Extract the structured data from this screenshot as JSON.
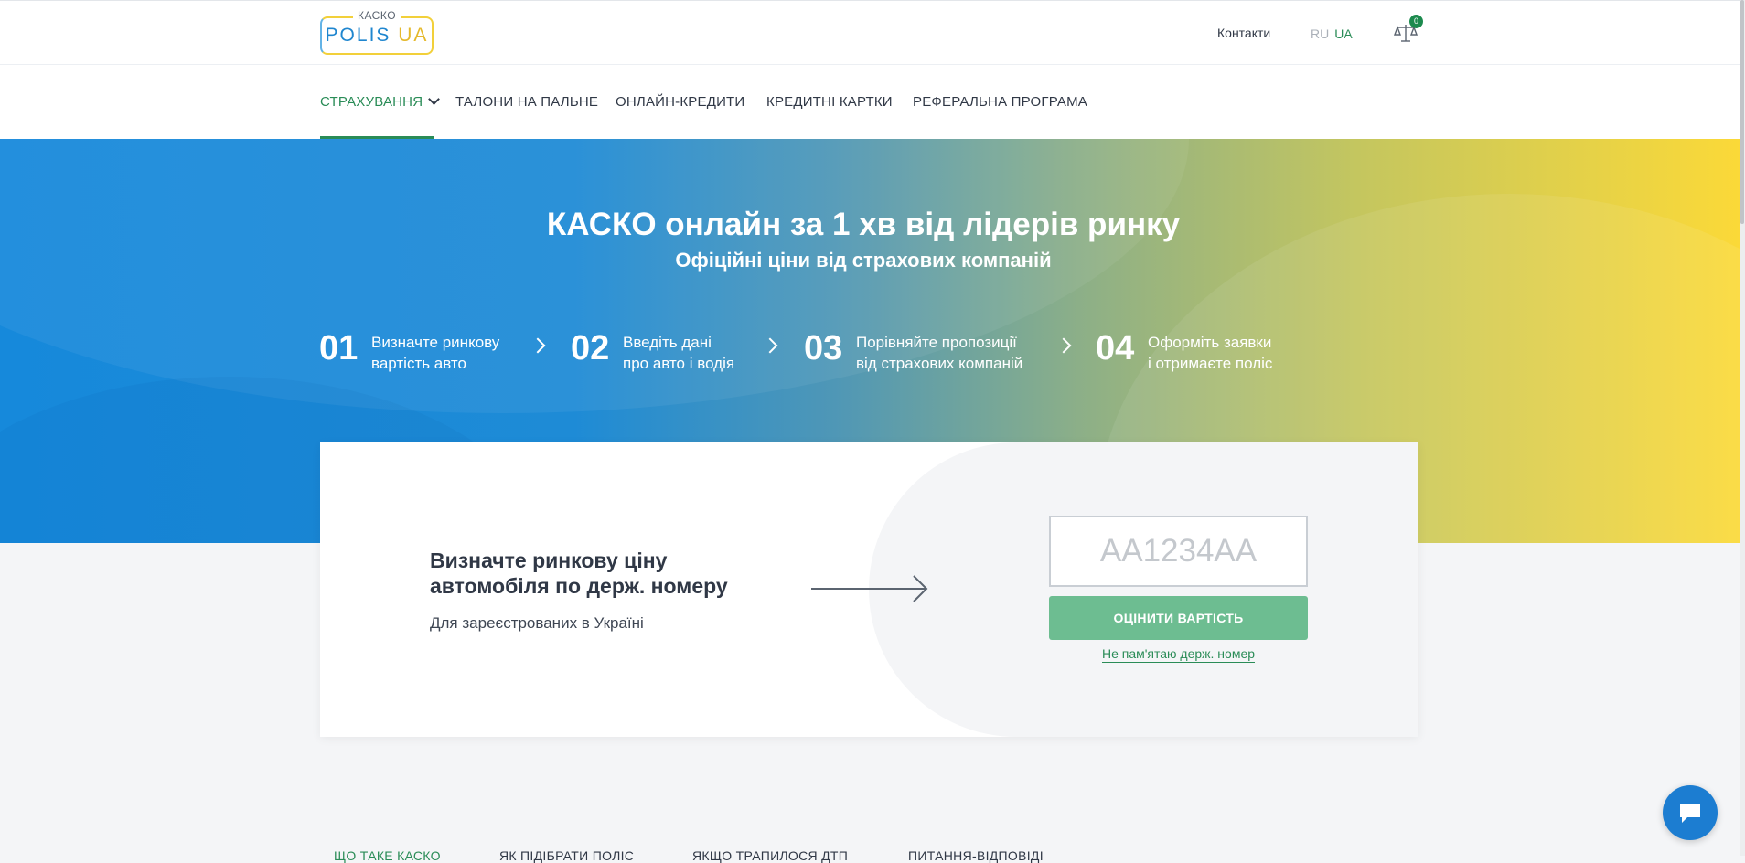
{
  "header": {
    "logo_top": "КАСКО",
    "logo_main": "POLIS",
    "logo_ua": "UA",
    "contacts": "Контакти",
    "lang_ru": "RU",
    "lang_ua": "UA",
    "compare_count": "0",
    "compare_icon": "scales-icon"
  },
  "nav": {
    "items": [
      {
        "label": "СТРАХУВАННЯ"
      },
      {
        "label": "ТАЛОНИ НА ПАЛЬНЕ"
      },
      {
        "label": "ОНЛАЙН-КРЕДИТИ"
      },
      {
        "label": "КРЕДИТНІ КАРТКИ"
      },
      {
        "label": "РЕФЕРАЛЬНА ПРОГРАМА"
      }
    ]
  },
  "hero": {
    "title": "КАСКО онлайн за 1 хв від лідерів ринку",
    "subtitle": "Офіційні ціни від страхових компаній",
    "steps": [
      {
        "num": "01",
        "line1": "Визначте ринкову",
        "line2": "вартість авто"
      },
      {
        "num": "02",
        "line1": "Введіть дані",
        "line2": "про авто і водія"
      },
      {
        "num": "03",
        "line1": "Порівняйте пропозиції",
        "line2": "від страхових компаній"
      },
      {
        "num": "04",
        "line1": "Оформіть заявки",
        "line2": "і отримаєте поліс"
      }
    ]
  },
  "card": {
    "title": "Визначте ринкову ціну автомобіля по держ. номеру",
    "subtitle": "Для зареєстрованих в Україні",
    "plate_placeholder": "AA1234AA",
    "button": "ОЦІНИТИ ВАРТІСТЬ",
    "forgot_link": "Не пам'ятаю держ. номер"
  },
  "bottom_tabs": [
    {
      "label": "ЩО ТАКЕ КАСКО"
    },
    {
      "label": "ЯК ПІДІБРАТИ ПОЛІС"
    },
    {
      "label": "ЯКЩО ТРАПИЛОСЯ ДТП"
    },
    {
      "label": "ПИТАННЯ-ВІДПОВІДІ"
    }
  ],
  "colors": {
    "accent_green": "#2a8c57",
    "button_green": "#6dbd91",
    "hero_blue": "#1689db",
    "hero_yellow": "#fbd938",
    "chat_blue": "#1c7dd1"
  }
}
